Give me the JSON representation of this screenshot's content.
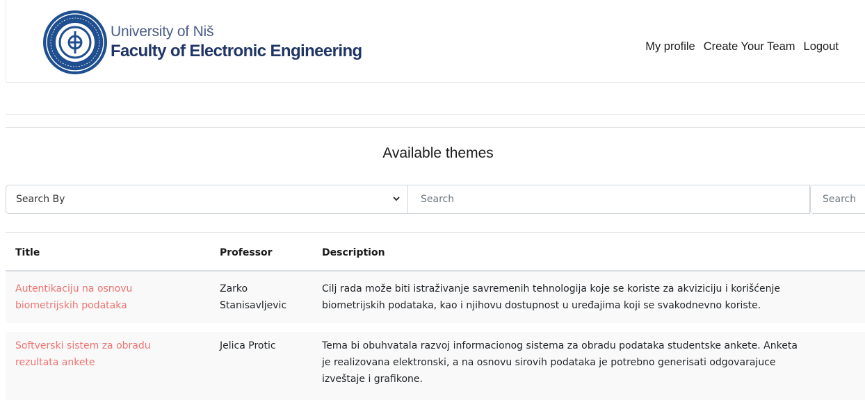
{
  "header": {
    "university": "University of Niš",
    "faculty": "Faculty of Electronic Engineering",
    "logo_icon": "university-seal-logo",
    "nav": [
      {
        "label": "My profile"
      },
      {
        "label": "Create Your Team"
      },
      {
        "label": "Logout"
      }
    ]
  },
  "main": {
    "title": "Available themes",
    "search": {
      "select_value": "Search By",
      "input_placeholder": "Search",
      "button_label": "Search"
    },
    "table": {
      "columns": [
        "Title",
        "Professor",
        "Description"
      ],
      "rows": [
        {
          "title_line1": "Autentikaciju na osnovu",
          "title_line2": "biometrijskih podataka",
          "professor_line1": "Zarko",
          "professor_line2": "Stanisavljevic",
          "description_line1": "Cilj rada može biti istraživanje savremenih tehnologija koje se koriste za akviziciju i korišćenje",
          "description_line2": "biometrijskih podataka, kao i njihovu dostupnost u uređajima koji se svakodnevno koriste."
        },
        {
          "title_line1": "Softverski sistem za obradu",
          "title_line2": "rezultata ankete",
          "professor_line1": "Jelica Protic",
          "description_line1": "Tema bi obuhvatala razvoj informacionog sistema za obradu podataka studentske ankete. Anketa",
          "description_line2": "je realizovana elektronski, a na osnovu sirovih podataka je potrebno generisati odgovarajuce",
          "description_line3": "izveštaje i grafikone."
        }
      ]
    }
  },
  "colors": {
    "title_link": "#ef7370",
    "brand_navy": "#1f3565"
  }
}
